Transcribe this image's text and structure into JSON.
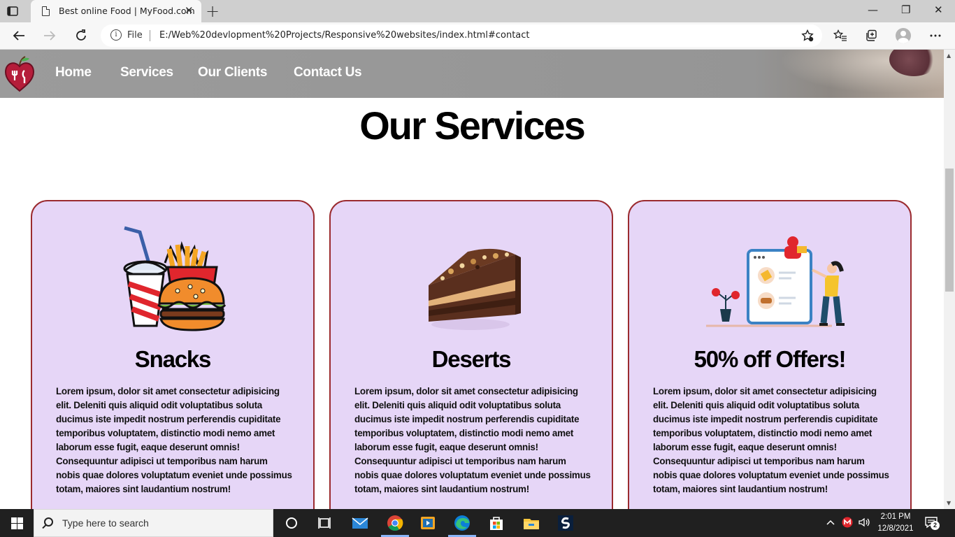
{
  "browser": {
    "tab_title": "Best online Food | MyFood.com",
    "tab_close": "✕",
    "new_tab": "+",
    "address_scheme": "File",
    "address_url": "E:/Web%20devlopment%20Projects/Responsive%20websites/index.html#contact",
    "window_controls": [
      "—",
      "❐",
      "✕"
    ]
  },
  "site": {
    "nav": {
      "items": [
        "Home",
        "Services",
        "Our Clients",
        "Contact Us"
      ]
    },
    "services": {
      "title": "Our Services",
      "cards": [
        {
          "heading": "Snacks",
          "image": "snacks-illustration",
          "text": "Lorem ipsum, dolor sit amet consectetur adipisicing elit. Deleniti quis aliquid odit voluptatibus soluta ducimus iste impedit nostrum perferendis cupiditate temporibus voluptatem, distinctio modi nemo amet laborum esse fugit, eaque deserunt omnis! Consequuntur adipisci ut temporibus nam harum nobis quae dolores voluptatum eveniet unde possimus totam, maiores sint laudantium nostrum!"
        },
        {
          "heading": "Deserts",
          "image": "cake-slice-photo",
          "text": "Lorem ipsum, dolor sit amet consectetur adipisicing elit. Deleniti quis aliquid odit voluptatibus soluta ducimus iste impedit nostrum perferendis cupiditate temporibus voluptatem, distinctio modi nemo amet laborum esse fugit, eaque deserunt omnis! Consequuntur adipisci ut temporibus nam harum nobis quae dolores voluptatum eveniet unde possimus totam, maiores sint laudantium nostrum!"
        },
        {
          "heading": "50% off Offers!",
          "image": "online-order-illustration",
          "text": "Lorem ipsum, dolor sit amet consectetur adipisicing elit. Deleniti quis aliquid odit voluptatibus soluta ducimus iste impedit nostrum perferendis cupiditate temporibus voluptatem, distinctio modi nemo amet laborum esse fugit, eaque deserunt omnis! Consequuntur adipisci ut temporibus nam harum nobis quae dolores voluptatum eveniet unde possimus totam, maiores sint laudantium nostrum!"
        }
      ]
    }
  },
  "colors": {
    "card_bg": "#e6d6f7",
    "card_border": "#9b2b2f",
    "nav_bg": "#9b9b9b"
  },
  "taskbar": {
    "search_placeholder": "Type here to search",
    "time": "2:01 PM",
    "date": "12/8/2021",
    "notification_count": "2",
    "apps": [
      "task-view-icon",
      "widgets-icon",
      "mail-icon",
      "chrome-icon",
      "media-player-icon",
      "edge-icon",
      "store-icon",
      "file-explorer-icon",
      "s-app-icon"
    ]
  }
}
